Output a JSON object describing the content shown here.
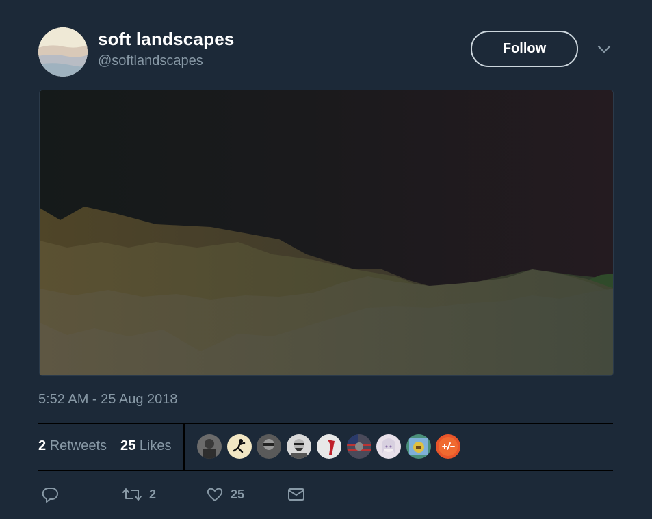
{
  "user": {
    "display_name": "soft landscapes",
    "handle": "@softlandscapes"
  },
  "follow_label": "Follow",
  "media": {
    "description_icon": "landscape-image"
  },
  "timestamp": "5:52 AM - 25 Aug 2018",
  "stats": {
    "retweets_count": "2",
    "retweets_label": "Retweets",
    "likes_count": "25",
    "likes_label": "Likes"
  },
  "liker_avatars": [
    {
      "icon": "liker-avatar-1",
      "color": "#6b6b6b"
    },
    {
      "icon": "liker-avatar-2",
      "color": "#f2e7c4"
    },
    {
      "icon": "liker-avatar-3",
      "color": "#5a5a5a"
    },
    {
      "icon": "liker-avatar-4",
      "color": "#d9d9d9"
    },
    {
      "icon": "liker-avatar-5",
      "color": "#e8e8e8"
    },
    {
      "icon": "liker-avatar-6",
      "color": "#4a4a5a"
    },
    {
      "icon": "liker-avatar-7",
      "color": "#e8e0ea"
    },
    {
      "icon": "liker-avatar-8",
      "color": "#4a8f7a"
    },
    {
      "icon": "liker-avatar-9",
      "color": "#e8552a"
    }
  ],
  "actions": {
    "reply_icon": "reply-icon",
    "retweet_count": "2",
    "like_count": "25",
    "dm_icon": "envelope-icon"
  },
  "colors": {
    "background": "#1c2938",
    "secondary_text": "#8899a6",
    "divider": "#000000"
  }
}
